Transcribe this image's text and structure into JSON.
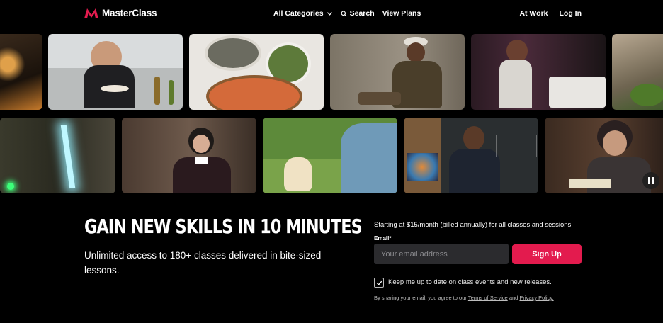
{
  "nav": {
    "brand": "MasterClass",
    "all_categories": "All Categories",
    "search": "Search",
    "view_plans": "View Plans",
    "at_work": "At Work",
    "log_in": "Log In"
  },
  "hero": {
    "headline": "GAIN NEW SKILLS IN 10 MINUTES",
    "subtext": "Unlimited access to 180+ classes delivered in bite-sized lessons."
  },
  "signup": {
    "pricing": "Starting at $15/month (billed annually) for all classes and sessions",
    "email_label": "Email*",
    "email_placeholder": "Your email address",
    "email_value": "",
    "button": "Sign Up",
    "checkbox_checked": true,
    "checkbox_label": "Keep me up to date on class events and new releases.",
    "legal_prefix": "By sharing your email, you agree to our",
    "terms": "Terms of Service",
    "and": "and",
    "privacy": "Privacy Policy."
  },
  "colors": {
    "accent": "#e31b4e",
    "background": "#000000",
    "input_bg": "#2b2b2e"
  },
  "icons": {
    "logo": "masterclass-logo-icon",
    "chevron": "chevron-down-icon",
    "search": "search-icon",
    "checkbox": "checkmark-icon",
    "pause": "pause-icon"
  }
}
